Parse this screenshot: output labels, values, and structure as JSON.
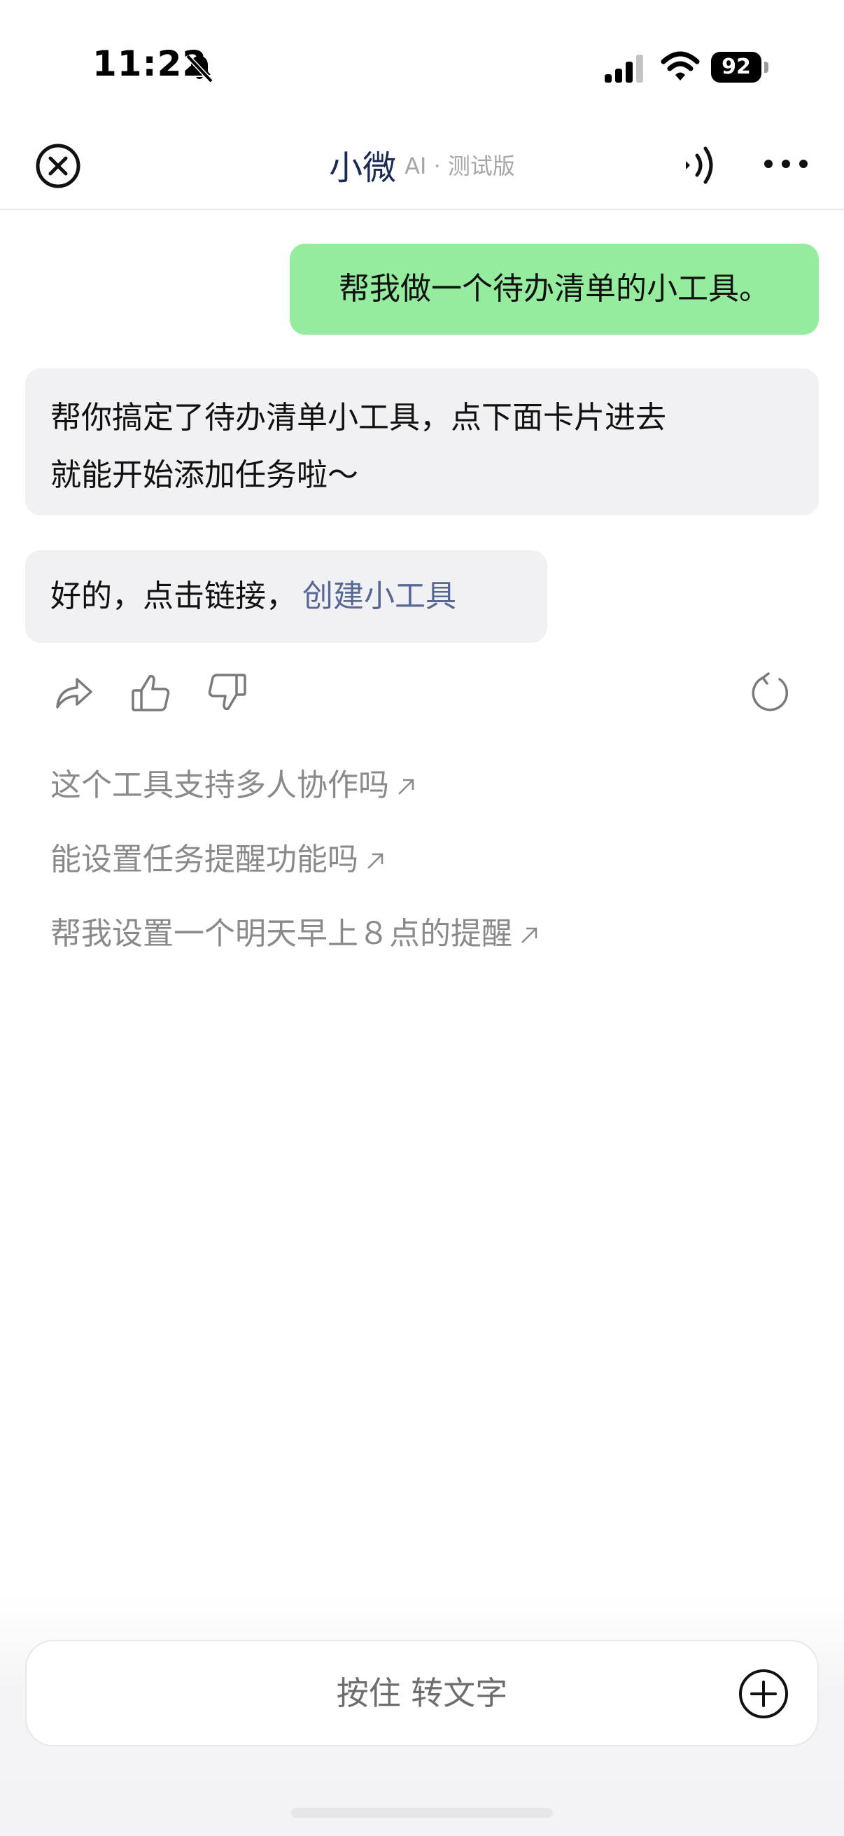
{
  "status_bar": {
    "time": "11:22",
    "battery": "92",
    "icons": [
      "bell-slash-icon",
      "signal-icon",
      "wifi-icon",
      "battery-icon"
    ]
  },
  "nav": {
    "title": "小微",
    "subtitle": "AI · 测试版",
    "icons": [
      "close-icon",
      "sound-icon",
      "more-icon"
    ]
  },
  "conversation": {
    "user_message": "帮我做一个待办清单的小工具。",
    "bot_message_line1": "帮你搞定了待办清单小工具，点下面卡片进去",
    "bot_message_line2": "就能开始添加任务啦～",
    "bot_message2_prefix": "好的，点击链接，",
    "bot_message2_link": "创建小工具"
  },
  "actions": {
    "icons": [
      "share-icon",
      "thumbs-up-icon",
      "thumbs-down-icon",
      "refresh-icon"
    ]
  },
  "suggestions": [
    "这个工具支持多人协作吗",
    "能设置任务提醒功能吗",
    "帮我设置一个明天早上８点的提醒"
  ],
  "input": {
    "placeholder": "按住 转文字",
    "icons": [
      "plus-icon"
    ]
  },
  "colors": {
    "user_bubble": "#95ec9e",
    "bot_bubble": "#f1f1f3",
    "link": "#586892",
    "title": "#1b2a55",
    "suggestion_text": "#8a8a8a"
  }
}
